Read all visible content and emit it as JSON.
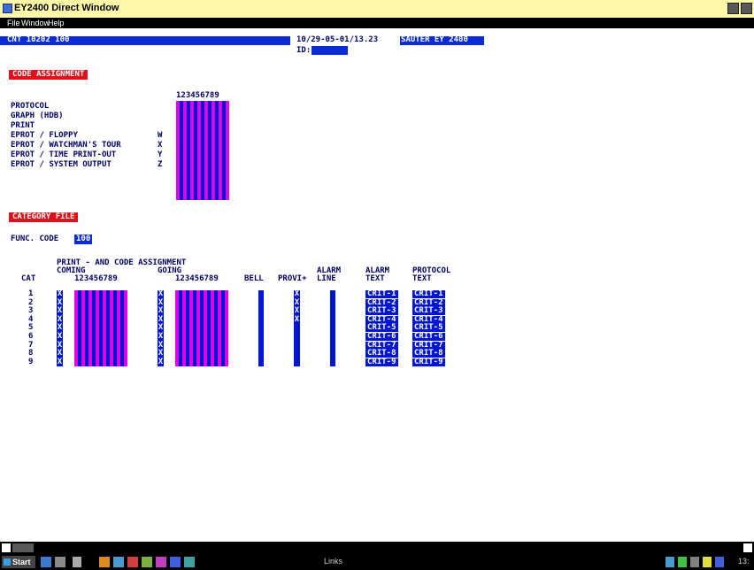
{
  "window": {
    "title": "EY2400 Direct Window"
  },
  "menu": [
    "File",
    "Window",
    "Help"
  ],
  "status": {
    "left": "CNT 10202 100",
    "datetime": "10/29-05-01/13.23",
    "system": "SAUTER EY 2400",
    "id_label": "ID:"
  },
  "code_assignment": {
    "title": "CODE ASSIGNMENT",
    "digits": "123456789",
    "rows": [
      {
        "label": "PROTOCOL",
        "code": ""
      },
      {
        "label": "GRAPH (HDB)",
        "code": ""
      },
      {
        "label": "PRINT",
        "code": ""
      },
      {
        "label": "EPROT / FLOPPY",
        "code": "W"
      },
      {
        "label": "EPROT / WATCHMAN'S TOUR",
        "code": "X"
      },
      {
        "label": "EPROT / TIME PRINT-OUT",
        "code": "Y"
      },
      {
        "label": "EPROT / SYSTEM OUTPUT",
        "code": "Z"
      }
    ]
  },
  "category_file": {
    "title": "CATEGORY FILE",
    "func_code_label": "FUNC. CODE",
    "func_code_value": "100",
    "print_header": "PRINT - AND CODE ASSIGNMENT",
    "coming": "COMING",
    "going": "GOING",
    "digits": "123456789",
    "col_cat": "CAT",
    "col_bell": "BELL",
    "col_provi": "PROVI+",
    "col_alarm1": "ALARM",
    "col_alarm2": "LINE",
    "col_alarm_text1": "ALARM",
    "col_alarm_text2": "TEXT",
    "col_protocol1": "PROTOCOL",
    "col_protocol2": "TEXT",
    "cats": [
      "1",
      "2",
      "3",
      "4",
      "5",
      "6",
      "7",
      "8",
      "9"
    ],
    "alarm_text": [
      "CRIT-1",
      "CRIT-2",
      "CRIT-3",
      "CRIT-4",
      "CRIT-5",
      "CRIT-6",
      "CRIT-7",
      "CRIT-8",
      "CRIT-9"
    ],
    "protocol_text": [
      "CRIT-1",
      "CRIT-2",
      "CRIT-3",
      "CRIT-4",
      "CRIT-5",
      "CRIT-6",
      "CRIT-7",
      "CRIT-8",
      "CRIT-9"
    ],
    "x_mark": "X"
  },
  "taskbar": {
    "start": "Start",
    "links": "Links",
    "clock": "13:"
  }
}
